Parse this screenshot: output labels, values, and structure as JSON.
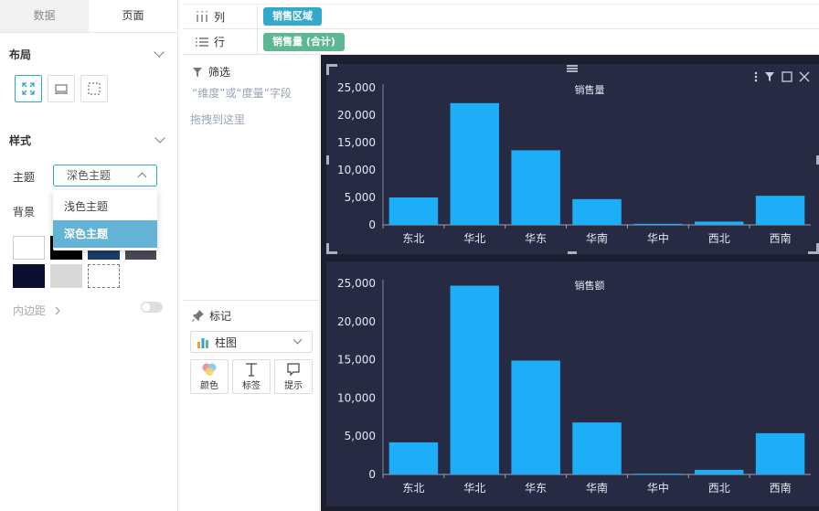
{
  "left_panel": {
    "tabs": [
      "数据",
      "页面"
    ],
    "layout_title": "布局",
    "style_title": "样式",
    "theme_label": "主题",
    "theme_value": "深色主题",
    "theme_options": [
      "浅色主题",
      "深色主题"
    ],
    "background_label": "背景",
    "padding_label": "内边距",
    "background_swatches": [
      "#ffffff",
      "#000000",
      "#1a3d66",
      "#4a4a55",
      "#0b1033",
      "#d9d9d9",
      "transparent"
    ]
  },
  "shelves": {
    "columns_label": "列",
    "columns_field": "销售区域",
    "rows_label": "行",
    "rows_field": "销售量 (合计)"
  },
  "filter": {
    "title": "筛选",
    "hint": "“维度”或“度量”字段",
    "hint2": "拖拽到这里"
  },
  "marks": {
    "title": "标记",
    "chart_type": "柱图",
    "buttons": [
      "颜色",
      "标签",
      "提示"
    ]
  },
  "colors": {
    "accent": "#2ca6c9",
    "pill_columns": "#34a9c9",
    "pill_rows": "#5cb893",
    "bar": "#1eaef8",
    "dash_bg": "#1d1f31",
    "card_bg": "#262a42"
  },
  "chart_data": [
    {
      "type": "bar",
      "title": "销售量",
      "categories": [
        "东北",
        "华北",
        "华东",
        "华南",
        "华中",
        "西北",
        "西南"
      ],
      "values": [
        5000,
        22200,
        13600,
        4700,
        200,
        600,
        5300
      ],
      "ylim": [
        0,
        25000
      ],
      "yticks": [
        "0",
        "5,000",
        "10,000",
        "15,000",
        "20,000",
        "25,000"
      ],
      "grid": false,
      "selected": true
    },
    {
      "type": "bar",
      "title": "销售额",
      "categories": [
        "东北",
        "华北",
        "华东",
        "华南",
        "华中",
        "西北",
        "西南"
      ],
      "values": [
        4200,
        24700,
        14900,
        6800,
        100,
        600,
        5400
      ],
      "ylim": [
        0,
        25000
      ],
      "yticks": [
        "0",
        "5,000",
        "10,000",
        "15,000",
        "20,000",
        "25,000"
      ],
      "grid": false,
      "selected": false
    }
  ]
}
